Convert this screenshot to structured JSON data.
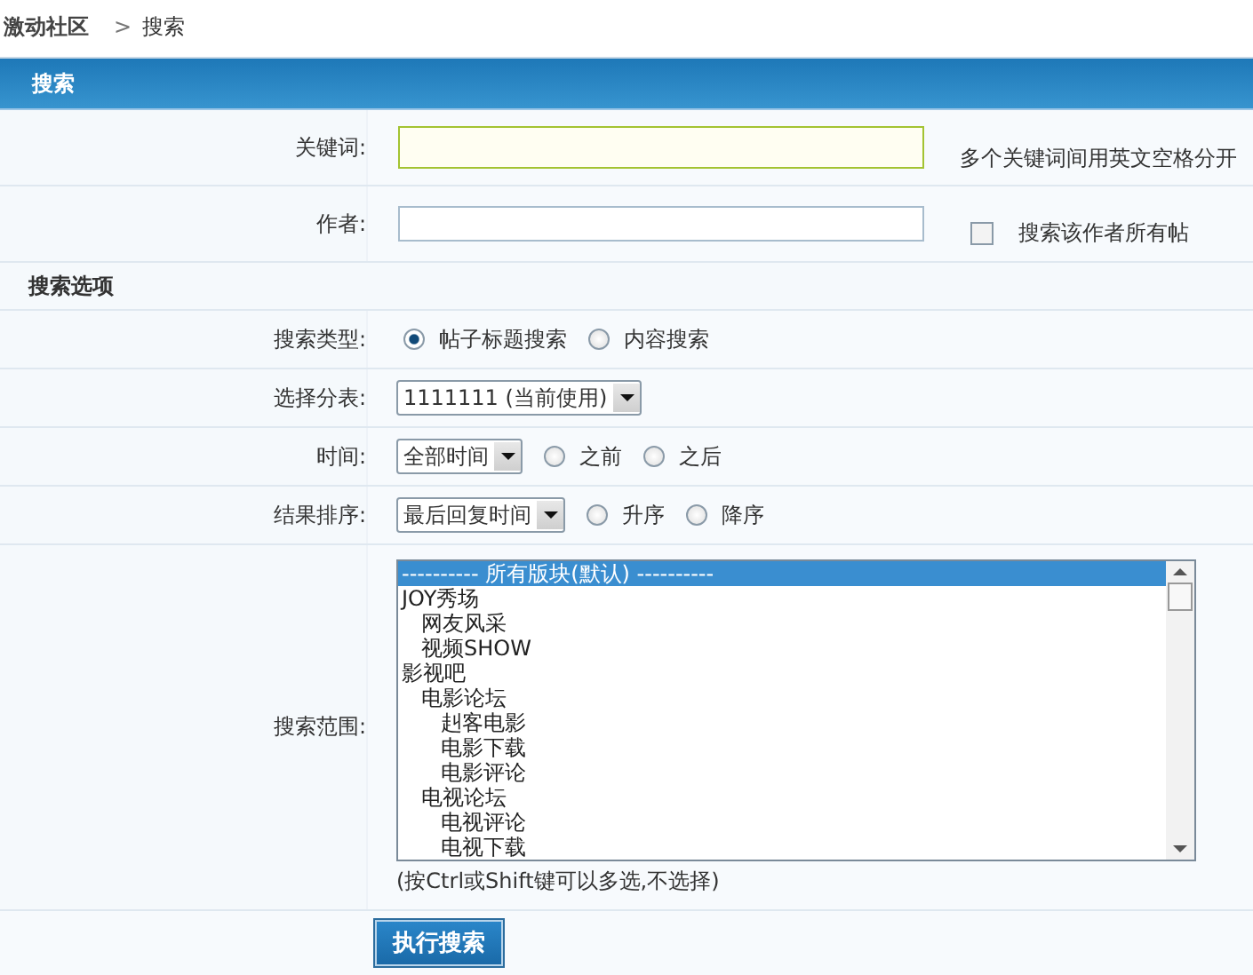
{
  "breadcrumb": {
    "site": "激动社区",
    "separator": ">",
    "current": "搜索"
  },
  "header": {
    "title": "搜索"
  },
  "keyword": {
    "label": "关键词:",
    "hint": "多个关键词间用英文空格分开"
  },
  "author": {
    "label": "作者:",
    "checkbox": {
      "label": "搜索该作者所有帖",
      "checked": false
    }
  },
  "options_heading": "搜索选项",
  "search_type": {
    "label": "搜索类型:",
    "options": [
      {
        "label": "帖子标题搜索",
        "selected": true
      },
      {
        "label": "内容搜索",
        "selected": false
      }
    ]
  },
  "table_select": {
    "label": "选择分表:",
    "value": "1111111 (当前使用)"
  },
  "time": {
    "label": "时间:",
    "value": "全部时间",
    "options": [
      {
        "label": "之前",
        "selected": false
      },
      {
        "label": "之后",
        "selected": false
      }
    ]
  },
  "sort": {
    "label": "结果排序:",
    "value": "最后回复时间",
    "options": [
      {
        "label": "升序",
        "selected": false
      },
      {
        "label": "降序",
        "selected": false
      }
    ]
  },
  "scope": {
    "label": "搜索范围:",
    "items": [
      {
        "label": "---------- 所有版块(默认) ----------",
        "selected": true
      },
      {
        "label": "JOY秀场",
        "selected": false,
        "children": [
          {
            "label": "网友风采",
            "selected": false
          },
          {
            "label": "视频SHOW",
            "selected": false
          }
        ]
      },
      {
        "label": "影视吧",
        "selected": false,
        "children": [
          {
            "label": "电影论坛",
            "selected": false,
            "children": [
              {
                "label": "赳客电影",
                "selected": false
              },
              {
                "label": "电影下载",
                "selected": false
              },
              {
                "label": "电影评论",
                "selected": false
              }
            ]
          },
          {
            "label": "电视论坛",
            "selected": false,
            "children": [
              {
                "label": "电视评论",
                "selected": false
              },
              {
                "label": "电视下载",
                "selected": false
              }
            ]
          }
        ]
      }
    ],
    "note": "(按Ctrl或Shift键可以多选,不选择)"
  },
  "submit": "执行搜索"
}
